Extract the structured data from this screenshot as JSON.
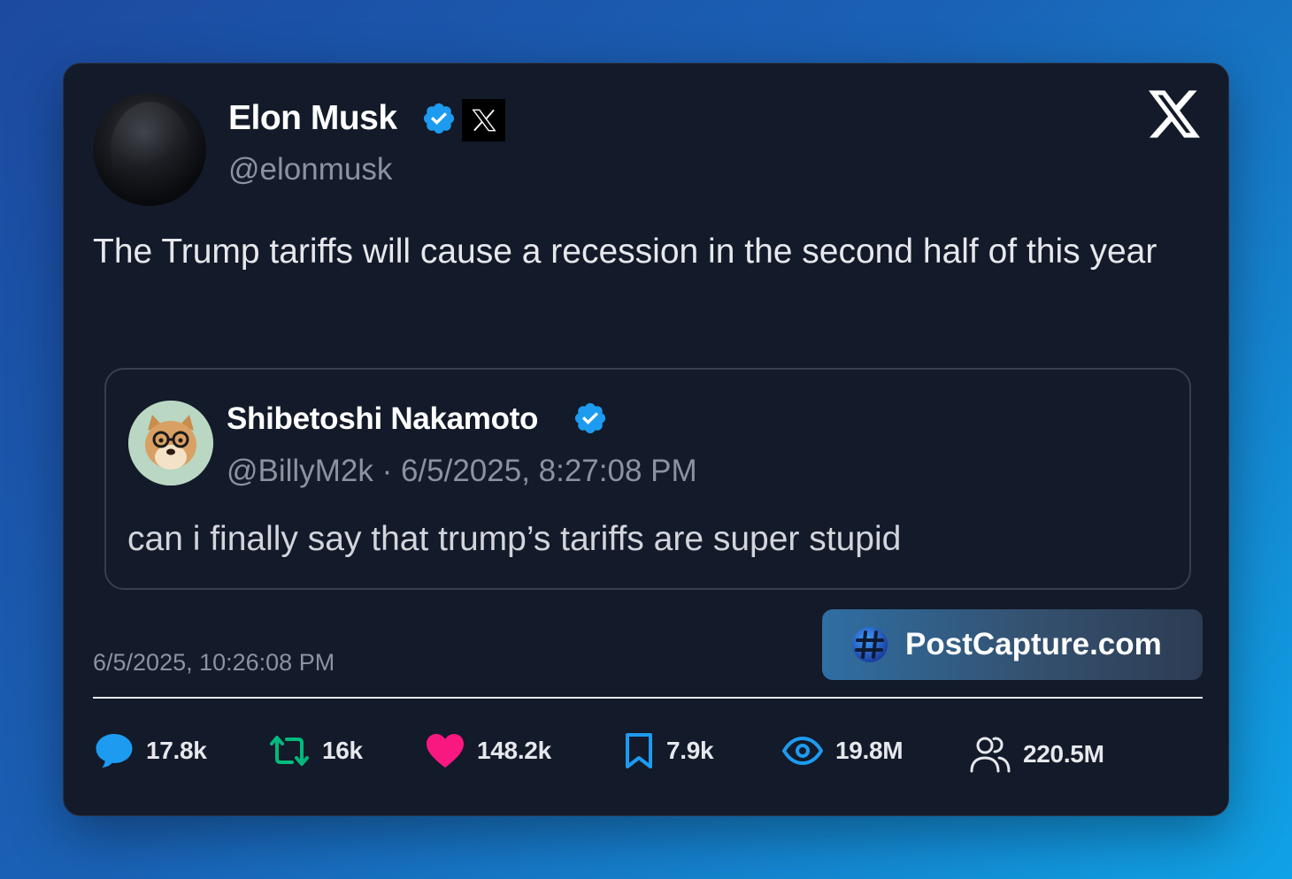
{
  "tweet": {
    "author_name": "Elon Musk",
    "handle": "@elonmusk",
    "text": "The Trump tariffs will cause a recession in the second half of this year",
    "timestamp": "6/5/2025, 10:26:08 PM"
  },
  "quote": {
    "author_name": "Shibetoshi Nakamoto",
    "handle": "@BillyM2k",
    "separator": "·",
    "timestamp": "6/5/2025, 8:27:08 PM",
    "text": "can i finally say that trump’s tariffs are super stupid"
  },
  "branding": {
    "button_label": "PostCapture.com"
  },
  "stats": {
    "replies": "17.8k",
    "reposts": "16k",
    "likes": "148.2k",
    "bookmarks": "7.9k",
    "views": "19.8M",
    "followers": "220.5M"
  },
  "colors": {
    "verified": "#1d9bf0",
    "reply": "#1d9bf0",
    "repost": "#00ba7c",
    "like": "#f91880",
    "bookmark": "#1d9bf0",
    "views": "#1d9bf0"
  },
  "icons": [
    "verified-badge-icon",
    "x-affiliate-badge-icon",
    "x-logo-icon",
    "hash-icon",
    "reply-bubble-icon",
    "repost-icon",
    "heart-icon",
    "bookmark-icon",
    "eye-icon",
    "people-icon"
  ]
}
